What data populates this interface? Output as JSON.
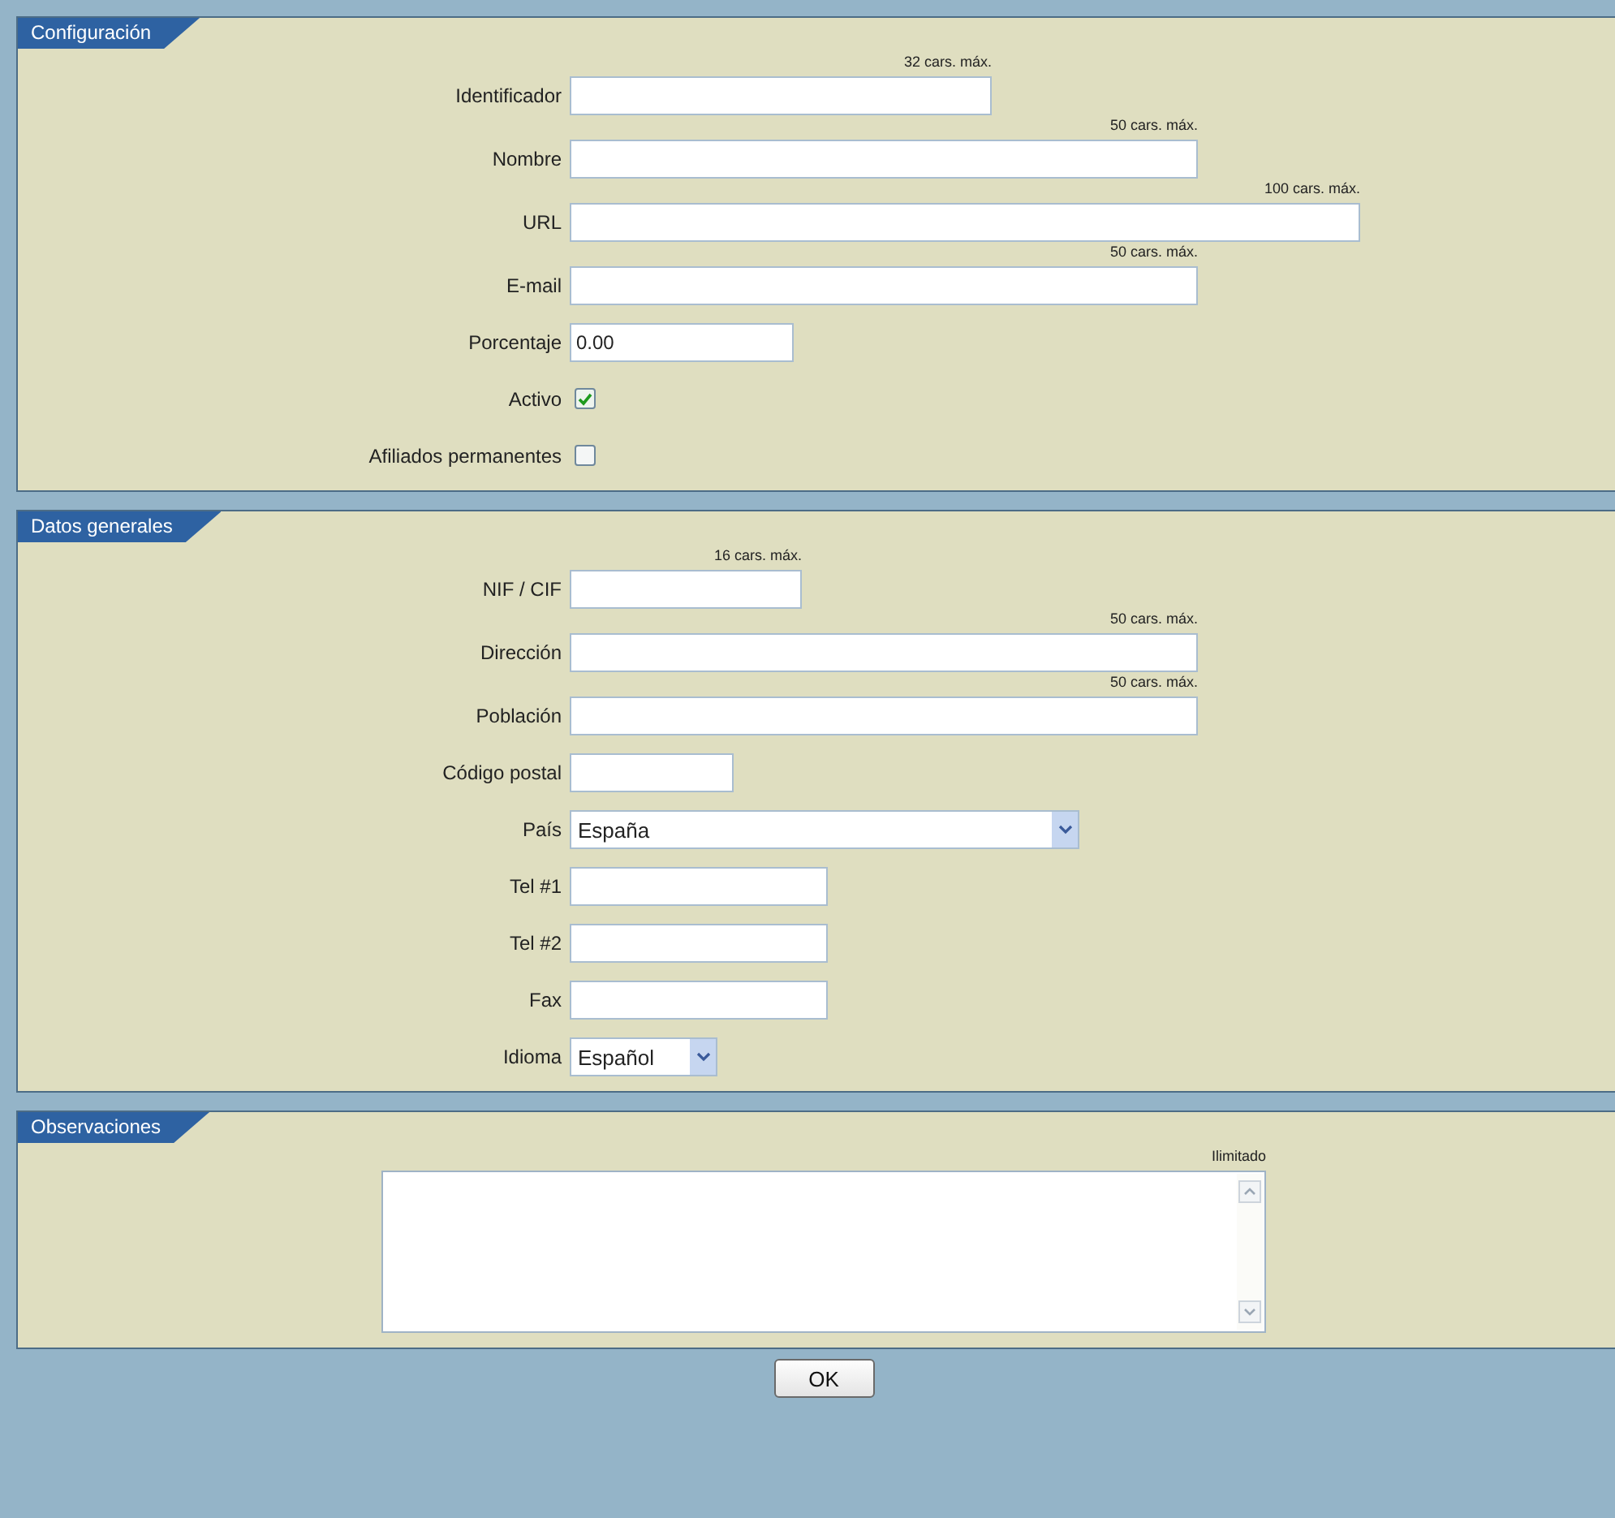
{
  "sections": [
    {
      "title": "Configuración",
      "fields": [
        {
          "kind": "text",
          "label": "Identificador",
          "note": "32 cars. máx."
        },
        {
          "kind": "text",
          "label": "Nombre",
          "note": "50 cars. máx."
        },
        {
          "kind": "text",
          "label": "URL",
          "note": "100 cars. máx."
        },
        {
          "kind": "text",
          "label": "E-mail",
          "note": "50 cars. máx."
        },
        {
          "kind": "text",
          "label": "Porcentaje",
          "value": "0.00"
        },
        {
          "kind": "checkbox",
          "label": "Activo",
          "checked": true
        },
        {
          "kind": "checkbox",
          "label": "Afiliados permanentes",
          "checked": false
        }
      ]
    },
    {
      "title": "Datos generales",
      "fields": [
        {
          "kind": "text",
          "label": "NIF / CIF",
          "note": "16 cars. máx."
        },
        {
          "kind": "text",
          "label": "Dirección",
          "note": "50 cars. máx."
        },
        {
          "kind": "text",
          "label": "Población",
          "note": "50 cars. máx."
        },
        {
          "kind": "text",
          "label": "Código postal"
        },
        {
          "kind": "select",
          "label": "País",
          "value": "España"
        },
        {
          "kind": "text",
          "label": "Tel #1"
        },
        {
          "kind": "text",
          "label": "Tel #2"
        },
        {
          "kind": "text",
          "label": "Fax"
        },
        {
          "kind": "select",
          "label": "Idioma",
          "value": "Español"
        }
      ]
    },
    {
      "title": "Observaciones",
      "fields": [
        {
          "kind": "textarea",
          "note": "Ilimitado"
        }
      ]
    }
  ],
  "ok_button": "OK"
}
